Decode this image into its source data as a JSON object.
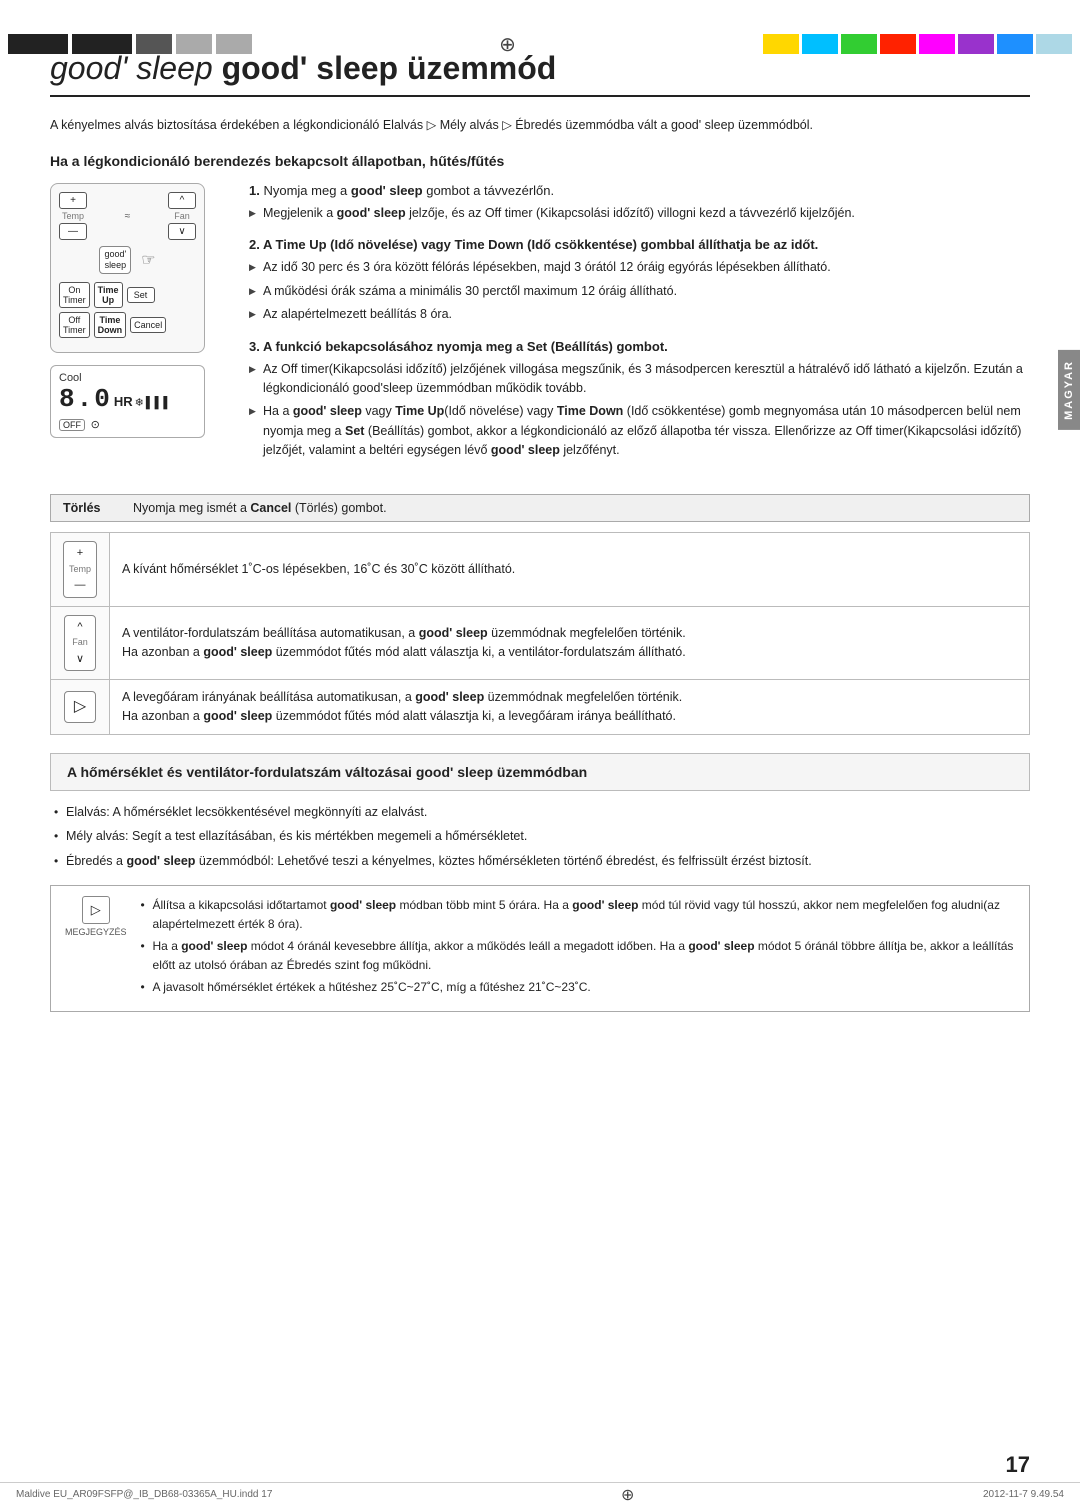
{
  "page": {
    "number": "17",
    "file_info_left": "Maldive EU_AR09FSFP@_IB_DB68-03365A_HU.indd   17",
    "file_info_right": "2012-11-7   9.49.54"
  },
  "header": {
    "title": "good' sleep üzemmód"
  },
  "sidebar_label": "MAGYAR",
  "intro": "A kényelmes alvás biztosítása érdekében a légkondicionáló Elalvás ▷ Mély alvás ▷ Ébredés üzemmódba vált a good' sleep üzemmódból.",
  "section1_heading": "Ha a légkondicionáló berendezés bekapcsolt állapotban, hűtés/fűtés",
  "steps": [
    {
      "number": "1",
      "title": "Nyomja meg a good' sleep gombot a távvezérlőn.",
      "bullets": [
        "Megjelenik a good' sleep jelzője, és az Off timer (Kikapcsolási időzítő) villogni kezd a távvezérlő kijelzőjén."
      ]
    },
    {
      "number": "2",
      "title": "A Time Up (Idő növelése) vagy Time Down (Idő csökkentése) gombbal állíthatja be az időt.",
      "bullets": [
        "Az idő 30 perc és 3 óra között félórás lépésekben, majd 3 órától 12 óráig egyórás lépésekben állítható.",
        "A működési órák száma a minimális 30 perctől maximum 12 óráig állítható.",
        "Az alapértelmezett beállítás 8 óra."
      ]
    },
    {
      "number": "3",
      "title": "A funkció bekapcsolásához nyomja meg a Set (Beállítás) gombot.",
      "bullets": [
        "Az Off timer(Kikapcsolási időzítő) jelzőjének villogása megszűnik, és 3 másodpercen keresztül a hátralévő idő látható a kijelzőn. Ezután a légkondicionáló good'sleep üzemmódban működik tovább.",
        "Ha a good' sleep vagy Time Up(Idő növelése) vagy Time Down (Idő csökkentése) gomb megnyomása után 10 másodpercen belül nem nyomja meg a Set (Beállítás) gombot, akkor a légkondicionáló az előző állapotba tér vissza. Ellenőrizze az Off timer(Kikapcsolási időzítő) jelzőjét, valamint a beltéri egységen lévő good' sleep jelzőfényt."
      ]
    }
  ],
  "cancel_row": {
    "label": "Törlés",
    "text": "Nyomja meg ismét a Cancel (Törlés) gombot."
  },
  "button_table": [
    {
      "icon_label": "+\nTemp\n—",
      "description": "A kívánt hőmérséklet 1˚C-os lépésekben, 16˚C és 30˚C között állítható."
    },
    {
      "icon_label": "^\nFan\n∨",
      "description": "A ventilátor-fordulatszám beállítása automatikusan, a good' sleep üzemmódnak megfelelően történik.\nHa azonban a good' sleep üzemmódot fűtés mód alatt választja ki, a ventilátor-fordulatszám állítható."
    },
    {
      "icon_label": "▷",
      "description": "A levegőáram irányának beállítása automatikusan, a good' sleep üzemmódnak megfelelően történik.\nHa azonban a good' sleep üzemmódot fűtés mód alatt választja ki, a levegőáram iránya beállítható."
    }
  ],
  "section2_heading": "A hőmérséklet és ventilátor-fordulatszám változásai good' sleep üzemmódban",
  "section2_bullets": [
    "Elalvás: A hőmérséklet lecsökkentésével megkönnyíti az elalvást.",
    "Mély alvás: Segít a test ellazításában, és kis mértékben megemeli a hőmérsékletet.",
    "Ébredés a good' sleep üzemmódból: Lehetővé teszi a kényelmes, köztes hőmérsékleten történő ébredést, és felfrissült érzést biztosít."
  ],
  "note": {
    "icon": "▷",
    "label": "MEGJEGYZÉS",
    "bullets": [
      "Állítsa a kikapcsolási időtartamot good' sleep módban több mint 5 órára. Ha a good' sleep mód túl rövid vagy túl hosszú, akkor nem megfelelően fog aludni(az alapértelmezett érték 8 óra).",
      "Ha a good' sleep módot 4 óránál kevesebbre állítja, akkor a működés leáll a megadott időben. Ha a good' sleep módot 5 óránál többre állítja be, akkor a leállítás előtt az utolsó órában az Ébredés szint fog működni.",
      "A javasolt hőmérséklet értékek a hűtéshez 25˚C~27˚C, míg a fűtéshez 21˚C~23˚C."
    ]
  },
  "remote": {
    "display_cool": "Cool",
    "display_digits": "8.0",
    "display_hr": "HR",
    "display_off": "OFF"
  }
}
